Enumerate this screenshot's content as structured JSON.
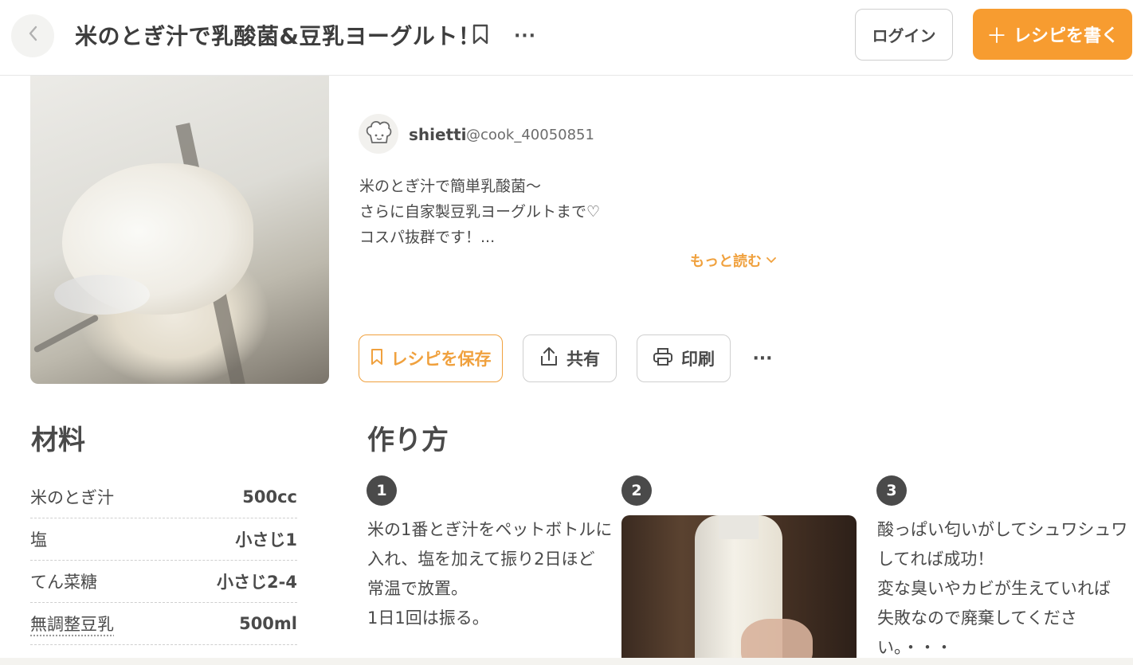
{
  "header": {
    "back_icon": "chevron-left-icon",
    "title": "米のとぎ汁で乳酸菌&豆乳ヨーグルト！",
    "more": "···",
    "login_label": "ログイン",
    "write_plus": "＋",
    "write_label": "レシピを書く"
  },
  "author": {
    "name": "shietti",
    "id": "@cook_40050851"
  },
  "description": {
    "lines": [
      "米のとぎ汁で簡単乳酸菌～",
      "さらに自家製豆乳ヨーグルトまで♡",
      "コスパ抜群です！..."
    ],
    "read_more": "もっと読む",
    "read_more_chevron": "⌄"
  },
  "actions": {
    "save_label": "レシピを保存",
    "share_label": "共有",
    "print_label": "印刷",
    "more": "···"
  },
  "ingredients": {
    "title": "材料",
    "items": [
      {
        "name": "米のとぎ汁",
        "qty": "500cc"
      },
      {
        "name": "塩",
        "qty": "小さじ1"
      },
      {
        "name": "てん菜糖",
        "qty": "小さじ2-4"
      },
      {
        "name": "無調整豆乳",
        "qty": "500ml"
      }
    ]
  },
  "steps": {
    "title": "作り方",
    "items": [
      {
        "num": "1",
        "lines": [
          "米の1番とぎ汁をペットボトルに",
          "入れ、塩を加えて振り2日ほど",
          "常温で放置。",
          "1日1回は振る。"
        ]
      },
      {
        "num": "2"
      },
      {
        "num": "3",
        "lines": [
          "酸っぱい匂いがしてシュワシュワ",
          "してれば成功！",
          "変な臭いやカビが生えていれば",
          "失敗なので廃棄してくださ",
          "い。・・・"
        ]
      }
    ]
  },
  "colors": {
    "accent": "#f79c30",
    "accent_text": "#f0a13e",
    "text": "#4a4a4a"
  }
}
